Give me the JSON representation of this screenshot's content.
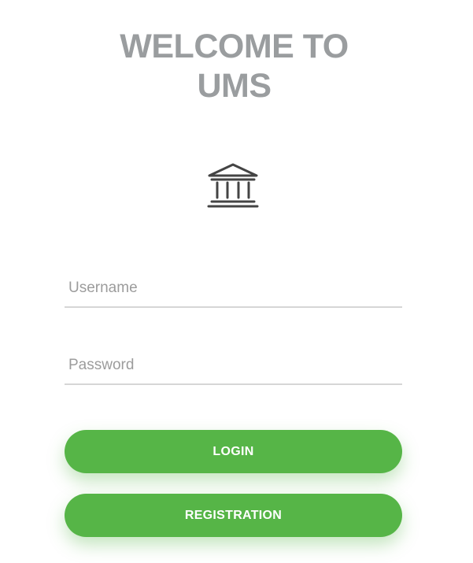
{
  "header": {
    "title_line1": "WELCOME TO",
    "title_line2": "UMS"
  },
  "logo": {
    "icon": "bank-building-icon"
  },
  "form": {
    "username_placeholder": "Username",
    "username_value": "",
    "password_placeholder": "Password",
    "password_value": ""
  },
  "actions": {
    "login_label": "LOGIN",
    "registration_label": "REGISTRATION"
  },
  "colors": {
    "title": "#9a9d9f",
    "button": "#56b547",
    "button_text": "#ffffff",
    "underline": "#d6d6d6",
    "icon": "#444444"
  }
}
